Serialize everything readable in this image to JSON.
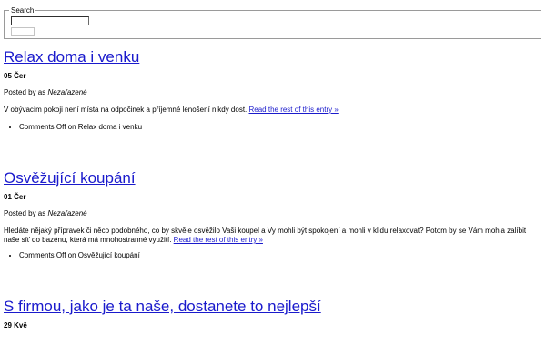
{
  "search": {
    "legend": "Search",
    "input_value": "",
    "button_label": ""
  },
  "posts": [
    {
      "title": "Relax doma i venku",
      "date": "05 Čer",
      "posted_by": "Posted by as",
      "category": "Nezařazené",
      "excerpt": "V obývacím pokoji není místa na odpočinek a příjemné lenošení nikdy dost.",
      "read_more": "Read the rest of this entry »",
      "comments": "Comments Off on Relax doma i venku"
    },
    {
      "title": "Osvěžující koupání",
      "date": "01 Čer",
      "posted_by": "Posted by as",
      "category": "Nezařazené",
      "excerpt": "Hledáte nějaký přípravek či něco podobného, co by skvěle osvěžilo Vaši koupel a Vy mohli být spokojení a mohli v klidu relaxovat? Potom by se Vám mohla zalíbit naše síť do bazénu, která má mnohostranné využití.",
      "read_more": "Read the rest of this entry »",
      "comments": "Comments Off on Osvěžující koupání"
    },
    {
      "title": "S firmou, jako je ta naše, dostanete to nejlepší",
      "date": "29 Kvě"
    }
  ]
}
